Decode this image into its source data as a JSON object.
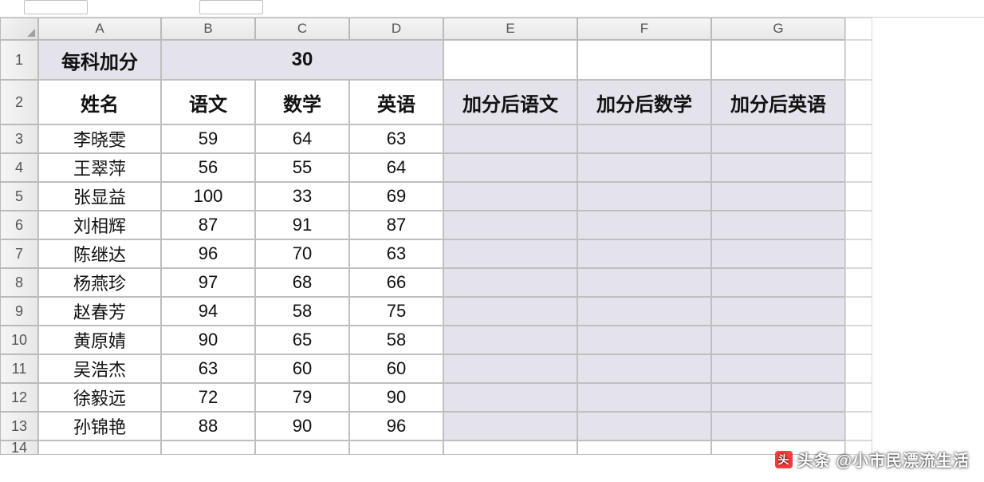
{
  "columns": [
    "A",
    "B",
    "C",
    "D",
    "E",
    "F",
    "G"
  ],
  "row_numbers": [
    1,
    2,
    3,
    4,
    5,
    6,
    7,
    8,
    9,
    10,
    11,
    12,
    13,
    14
  ],
  "header_row": {
    "a1": "每科加分",
    "merged_bcd": "30"
  },
  "subheader": {
    "name": "姓名",
    "chinese": "语文",
    "math": "数学",
    "english": "英语",
    "after_chinese": "加分后语文",
    "after_math": "加分后数学",
    "after_english": "加分后英语"
  },
  "rows": [
    {
      "name": "李晓雯",
      "chinese": 59,
      "math": 64,
      "english": 63
    },
    {
      "name": "王翠萍",
      "chinese": 56,
      "math": 55,
      "english": 64
    },
    {
      "name": "张显益",
      "chinese": 100,
      "math": 33,
      "english": 69
    },
    {
      "name": "刘相辉",
      "chinese": 87,
      "math": 91,
      "english": 87
    },
    {
      "name": "陈继达",
      "chinese": 96,
      "math": 70,
      "english": 63
    },
    {
      "name": "杨燕珍",
      "chinese": 97,
      "math": 68,
      "english": 66
    },
    {
      "name": "赵春芳",
      "chinese": 94,
      "math": 58,
      "english": 75
    },
    {
      "name": "黄原婧",
      "chinese": 90,
      "math": 65,
      "english": 58
    },
    {
      "name": "吴浩杰",
      "chinese": 63,
      "math": 60,
      "english": 60
    },
    {
      "name": "徐毅远",
      "chinese": 72,
      "math": 79,
      "english": 90
    },
    {
      "name": "孙锦艳",
      "chinese": 88,
      "math": 90,
      "english": 96
    }
  ],
  "watermark": "头条 @小市民漂流生活"
}
